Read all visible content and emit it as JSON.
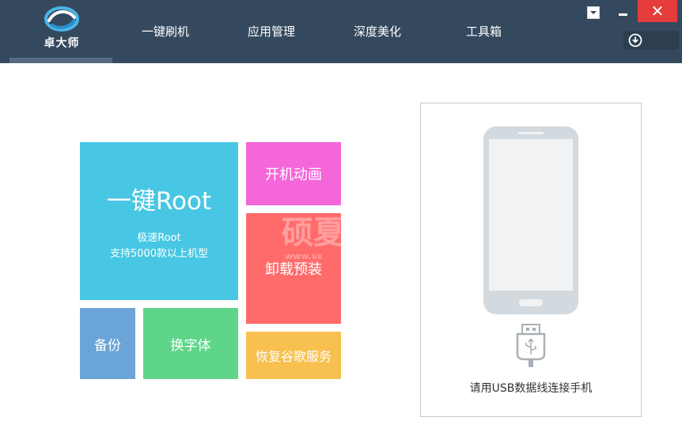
{
  "app": {
    "logo_text": "卓大师"
  },
  "nav": [
    {
      "label": "一键刷机"
    },
    {
      "label": "应用管理"
    },
    {
      "label": "深度美化"
    },
    {
      "label": "工具箱"
    }
  ],
  "window_controls": {
    "close_symbol": "✕"
  },
  "tiles": {
    "root": {
      "title": "一键Root",
      "line1": "极速Root",
      "line2": "支持5000款以上机型"
    },
    "boot_animation": "开机动画",
    "uninstall_preinstalled": "卸载预装",
    "backup": "备份",
    "change_font": "换字体",
    "restore_google": "恢复谷歌服务"
  },
  "device": {
    "hint": "请用USB数据线连接手机"
  },
  "colors": {
    "topbar": "#34495e",
    "root": "#47c7e3",
    "boot": "#f567d9",
    "uninstall": "#ff6b6b",
    "backup": "#6aa4d8",
    "font": "#5fd58a",
    "google": "#f8c04f",
    "close": "#e53c3c"
  },
  "icons": [
    "logo-cloud-icon",
    "dropdown-menu-icon",
    "minimize-icon",
    "close-icon",
    "download-icon",
    "phone-icon",
    "usb-icon"
  ],
  "watermark": {
    "text": "硕夏",
    "sub": "www.sx"
  }
}
